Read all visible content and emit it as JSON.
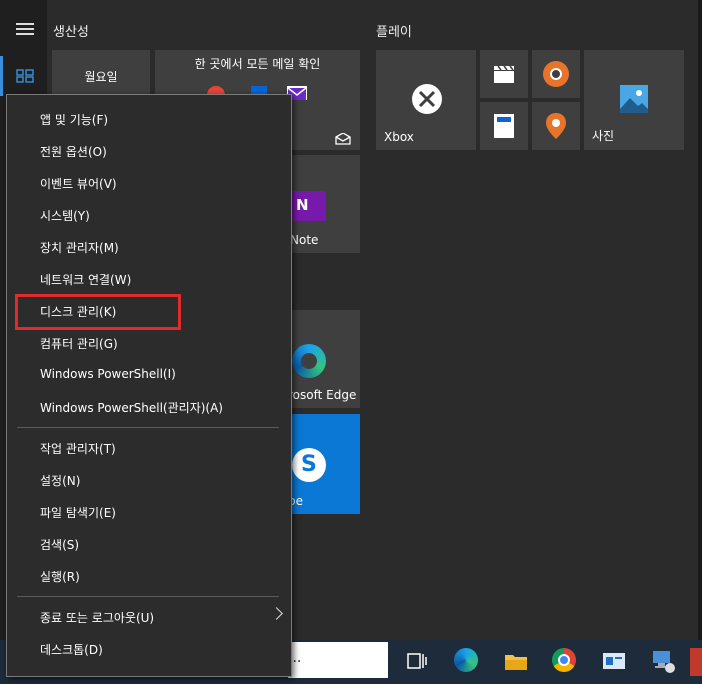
{
  "start": {
    "group_productivity": "생산성",
    "group_play": "플레이"
  },
  "tiles": {
    "calendar_label": "월요일",
    "mail_label": "한 곳에서 모든 메일 확인",
    "onenote_label": "Note",
    "edge_label": "rosoft Edge",
    "skype_label": "pe",
    "xbox_label": "Xbox",
    "photos_label": "사진"
  },
  "context_menu": {
    "items_group1": [
      "앱 및 기능(F)",
      "전원 옵션(O)",
      "이벤트 뷰어(V)",
      "시스템(Y)",
      "장치 관리자(M)",
      "네트워크 연결(W)",
      "디스크 관리(K)",
      "컴퓨터 관리(G)",
      "Windows PowerShell(I)",
      "Windows PowerShell(관리자)(A)"
    ],
    "items_group2": [
      "작업 관리자(T)",
      "설정(N)",
      "파일 탐색기(E)",
      "검색(S)",
      "실행(R)"
    ],
    "items_group3": [
      "종료 또는 로그아웃(U)",
      "데스크톱(D)"
    ],
    "highlighted_item": "디스크 관리(K)",
    "highlight_color": "#e12a2a"
  },
  "taskbar": {
    "search_partial": "..."
  },
  "colors": {
    "accent": "#3a8fdc",
    "skype": "#0a78d4",
    "onenote": "#7719aa"
  }
}
